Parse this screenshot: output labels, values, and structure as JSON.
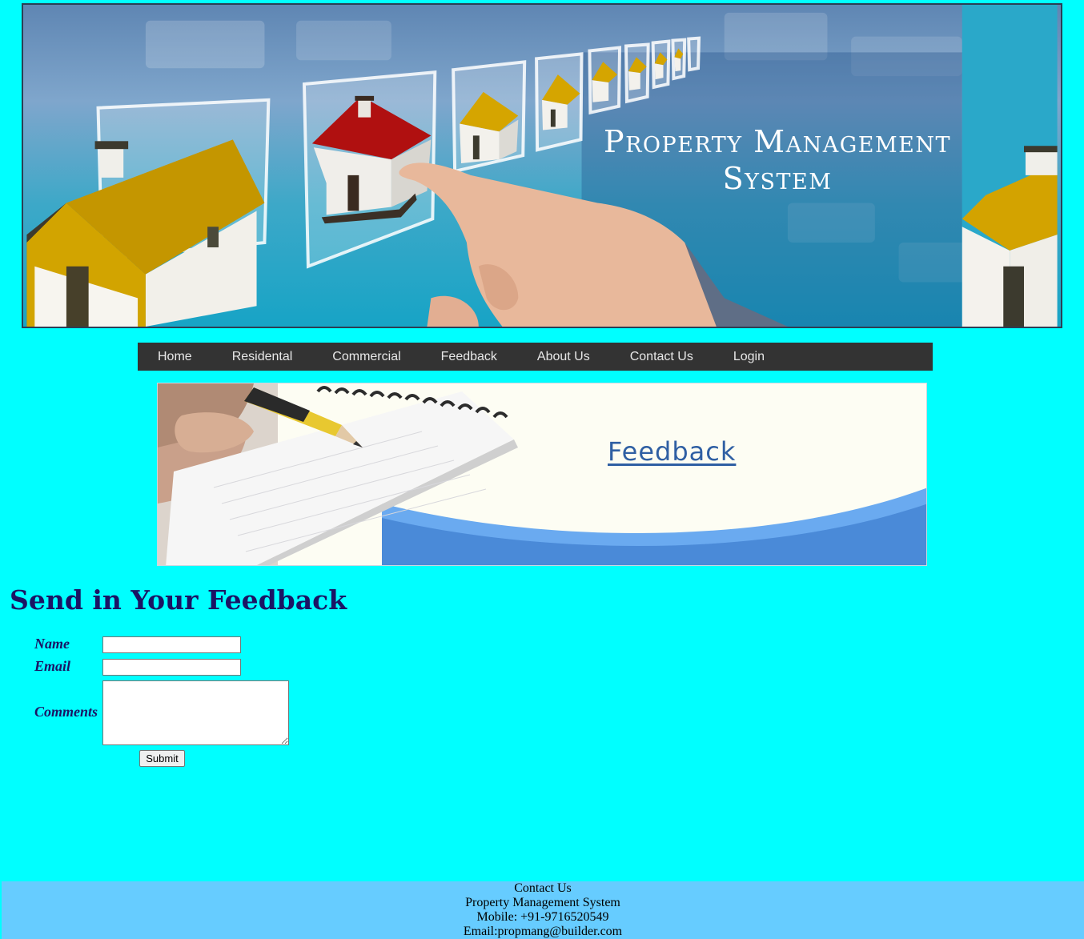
{
  "banner": {
    "title_line1": "Property Management",
    "title_line2": "System"
  },
  "nav": {
    "items": [
      {
        "label": "Home"
      },
      {
        "label": "Residental"
      },
      {
        "label": "Commercial"
      },
      {
        "label": "Feedback"
      },
      {
        "label": "About Us"
      },
      {
        "label": "Contact Us"
      },
      {
        "label": "Login"
      }
    ]
  },
  "feedback_image": {
    "word": "Feedback"
  },
  "form": {
    "heading": "Send in Your Feedback",
    "name_label": "Name",
    "email_label": "Email",
    "comments_label": "Comments",
    "name_value": "",
    "email_value": "",
    "comments_value": "",
    "submit_label": "Submit"
  },
  "footer": {
    "line1": "Contact Us",
    "line2": "Property Management System",
    "line3": "Mobile: +91-9716520549",
    "line4": "Email:propmang@builder.com"
  },
  "colors": {
    "page_background": "#00ffff",
    "nav_background": "#333333",
    "heading_color": "#1b1464",
    "footer_background": "#66ccff"
  }
}
